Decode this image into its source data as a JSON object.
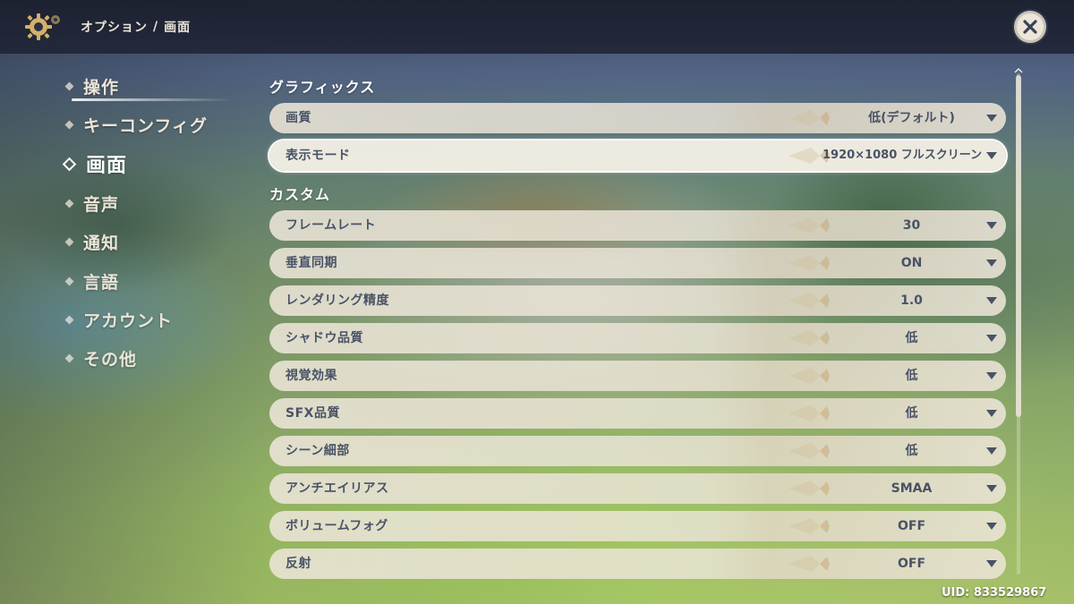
{
  "breadcrumb": {
    "parent": "オプション",
    "separator": "/",
    "current": "画面"
  },
  "nav": {
    "items": [
      {
        "label": "操作",
        "active": false
      },
      {
        "label": "キーコンフィグ",
        "active": false
      },
      {
        "label": "画面",
        "active": true
      },
      {
        "label": "音声",
        "active": false
      },
      {
        "label": "通知",
        "active": false
      },
      {
        "label": "言語",
        "active": false
      },
      {
        "label": "アカウント",
        "active": false
      },
      {
        "label": "その他",
        "active": false
      }
    ]
  },
  "sections": {
    "graphics": {
      "title": "グラフィックス",
      "rows": [
        {
          "label": "画質",
          "value": "低(デフォルト)"
        },
        {
          "label": "表示モード",
          "value": "1920×1080 フルスクリーン"
        }
      ]
    },
    "custom": {
      "title": "カスタム",
      "rows": [
        {
          "label": "フレームレート",
          "value": "30"
        },
        {
          "label": "垂直同期",
          "value": "ON"
        },
        {
          "label": "レンダリング精度",
          "value": "1.0"
        },
        {
          "label": "シャドウ品質",
          "value": "低"
        },
        {
          "label": "視覚効果",
          "value": "低"
        },
        {
          "label": "SFX品質",
          "value": "低"
        },
        {
          "label": "シーン細部",
          "value": "低"
        },
        {
          "label": "アンチエイリアス",
          "value": "SMAA"
        },
        {
          "label": "ボリュームフォグ",
          "value": "OFF"
        },
        {
          "label": "反射",
          "value": "OFF"
        }
      ]
    }
  },
  "uid": "UID: 833529867",
  "colors": {
    "panel": "#ece5d8",
    "text_dark": "#495366",
    "topbar": "#1c2130"
  }
}
